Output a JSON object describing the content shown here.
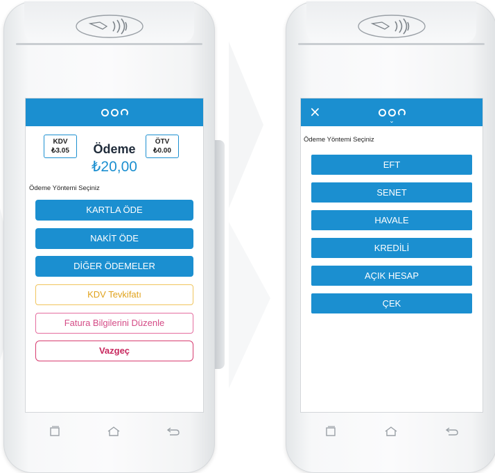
{
  "left_screen": {
    "kdv": {
      "label": "KDV",
      "value": "₺3.05"
    },
    "otv": {
      "label": "ÖTV",
      "value": "₺0.00"
    },
    "title": "Ödeme",
    "amount": "₺20,00",
    "section_label": "Ödeme Yöntemi Seçiniz",
    "buttons": {
      "card": "KARTLA ÖDE",
      "cash": "NAKİT ÖDE",
      "other": "DİĞER ÖDEMELER",
      "vat_withholding": "KDV Tevkifatı",
      "edit_invoice": "Fatura Bilgilerini Düzenle",
      "cancel": "Vazgeç"
    }
  },
  "right_screen": {
    "close_symbol": "×",
    "section_label": "Ödeme Yöntemi Seçiniz",
    "methods": [
      "EFT",
      "SENET",
      "HAVALE",
      "KREDİLİ",
      "AÇIK HESAP",
      "ÇEK"
    ]
  },
  "colors": {
    "accent": "#1b8fd0",
    "warning": "#f0c45c",
    "pink": "#e46c9e",
    "danger": "#d73b6f"
  },
  "icons": [
    "nfc-icon",
    "brand-logo-icon",
    "close-icon",
    "chevron-down-icon",
    "recent-apps-icon",
    "home-icon",
    "back-icon"
  ]
}
